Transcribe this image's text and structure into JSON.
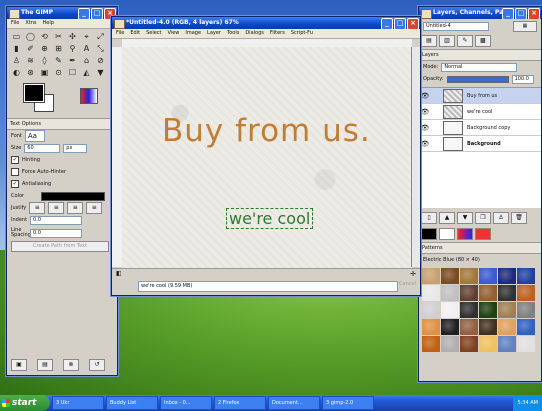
{
  "toolbox": {
    "title": "The GIMP",
    "menu": [
      "File",
      "Xtns",
      "Help"
    ],
    "tools": [
      "▭",
      "◯",
      "⟲",
      "✂",
      "✣",
      "⌖",
      "⤢",
      "▮",
      "✐",
      "⊕",
      "⊞",
      "⚲",
      "A",
      "⤡",
      "♙",
      "≋",
      "◊",
      "✎",
      "✒",
      "⌂",
      "⊘",
      "◐",
      "⊛",
      "▣",
      "⊙",
      "☐",
      "◭",
      "▼"
    ],
    "text_options": {
      "header": "Text Options",
      "font_label": "Font",
      "font_value": "Aa",
      "size_label": "Size",
      "size_value": "60",
      "size_unit": "px",
      "hinting": "Hinting",
      "force_autohinter": "Force Auto-Hinter",
      "antialiasing": "Antialiasing",
      "color_label": "Color",
      "justify_label": "Justify",
      "indent_label": "Indent",
      "indent_value": "0.0",
      "line_spacing_label": "Line Spacing",
      "line_spacing_value": "0.0",
      "create_path_label": "Create Path from Text"
    }
  },
  "image_window": {
    "title": "*Untitled-4.0 (RGB, 4 layers) 67%",
    "menu": [
      "File",
      "Edit",
      "Select",
      "View",
      "Image",
      "Layer",
      "Tools",
      "Dialogs",
      "Filters",
      "Script-Fu"
    ],
    "headline": "Buy from us.",
    "subline": "we're cool",
    "status": "we're cool (9.59 MB)",
    "cancel_label": "Cancel"
  },
  "layers_dock": {
    "title": "Layers, Channels, Pat...",
    "image_select": "Untitled-4",
    "tab_label": "Layers",
    "mode_label": "Mode:",
    "mode_value": "Normal",
    "opacity_label": "Opacity:",
    "opacity_value": "100.0",
    "layers": [
      {
        "name": "Buy from us",
        "selected": true
      },
      {
        "name": "we're cool",
        "selected": false
      },
      {
        "name": "Background copy",
        "selected": false
      },
      {
        "name": "Background",
        "selected": false
      }
    ],
    "patterns_header": "Patterns",
    "pattern_name": "Electric Blue (80 × 40)",
    "pattern_colors": [
      "#c8a070",
      "#7a4a20",
      "#a07838",
      "#3a5ad0",
      "#1a2a80",
      "#2040a0",
      "#e8e8e8",
      "#c0c0c0",
      "#604030",
      "#906030",
      "#303030",
      "#c06020",
      "#d0d0d0",
      "#f0f0f0",
      "#303030",
      "#204010",
      "#a08050",
      "#808080",
      "#e09040",
      "#202020",
      "#906040",
      "#403020",
      "#e0a060",
      "#3060c0",
      "#c06010",
      "#b0b0b0",
      "#804020",
      "#f0c060",
      "#6080c0",
      "#e0e0e0"
    ]
  },
  "taskbar": {
    "start_label": "start",
    "tasks": [
      "3 Ukr",
      "Buddy List",
      "Inbox - 0...",
      "2 Firefox",
      "Document...",
      "3 gimp-2.0"
    ],
    "clock": "5:34 AM"
  }
}
